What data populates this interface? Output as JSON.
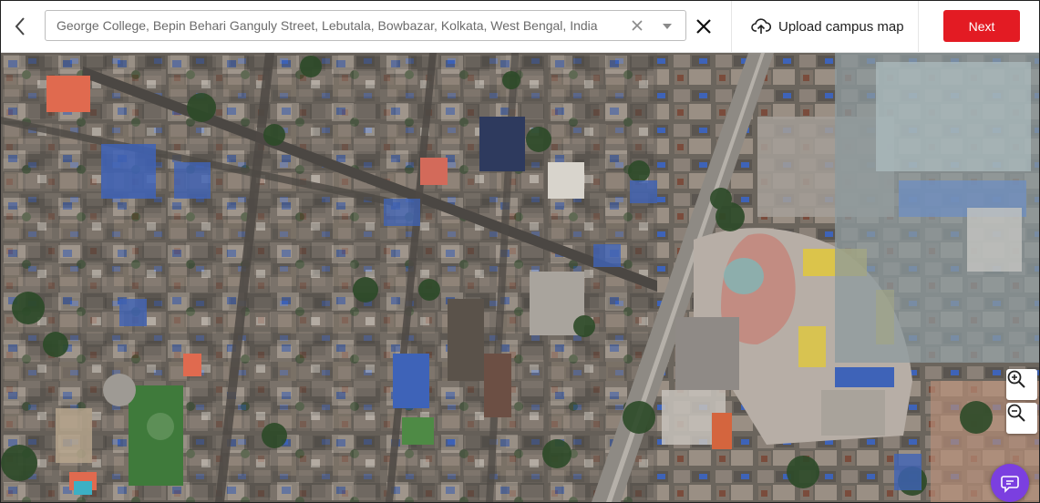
{
  "search": {
    "value": "George College, Bepin Behari Ganguly Street, Lebutala, Bowbazar, Kolkata, West Bengal, India"
  },
  "toolbar": {
    "upload_label": "Upload campus map",
    "next_label": "Next"
  },
  "icons": {
    "back": "chevron-left-icon",
    "clear": "clear-x-icon",
    "dropdown": "caret-down-icon",
    "close": "close-icon",
    "upload": "cloud-upload-icon",
    "zoom_in": "zoom-in-icon",
    "zoom_out": "zoom-out-icon",
    "chat": "chat-icon"
  },
  "colors": {
    "accent": "#e31b23",
    "chat": "#7b3fe0"
  }
}
